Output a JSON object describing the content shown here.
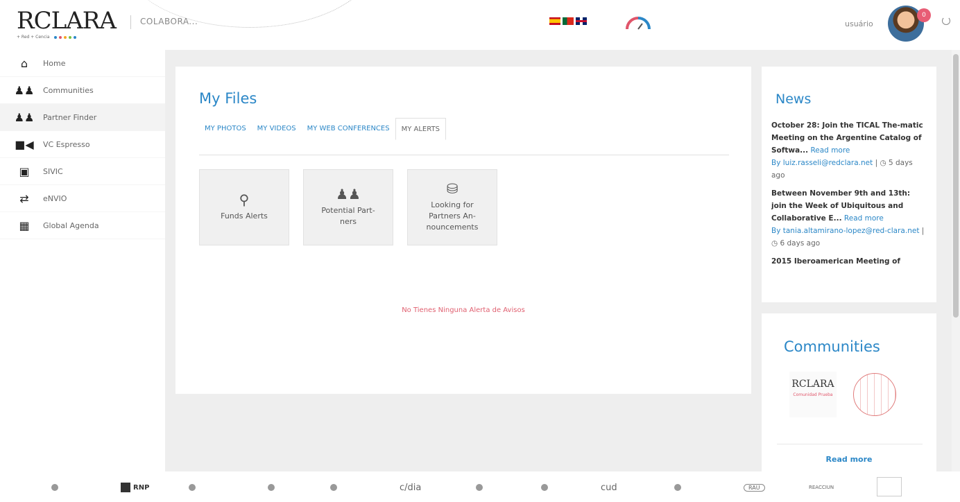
{
  "header": {
    "logo_mark": "RCLARA",
    "logo_tag": "+ Red + Cencia",
    "logo_dot_colors": [
      "#2b87c7",
      "#e0556a",
      "#f5a623",
      "#7ac143",
      "#2b87c7"
    ],
    "app_name": "COLABORA...",
    "languages": [
      "es",
      "pt",
      "en"
    ],
    "gauge_colors": [
      "#e0556a",
      "#2b87c7"
    ],
    "user_label": "usuário",
    "notification_count": "0"
  },
  "sidebar": {
    "items": [
      {
        "label": "Home",
        "icon": "home-icon"
      },
      {
        "label": "Communities",
        "icon": "group-icon"
      },
      {
        "label": "Partner Finder",
        "icon": "users-icon"
      },
      {
        "label": "VC Espresso",
        "icon": "video-camera-icon"
      },
      {
        "label": "SIVIC",
        "icon": "sivic-icon"
      },
      {
        "label": "eNVIO",
        "icon": "exchange-icon"
      },
      {
        "label": "Global Agenda",
        "icon": "calendar-icon"
      }
    ]
  },
  "main": {
    "title": "My Files",
    "tabs": [
      {
        "label": "MY PHOTOS"
      },
      {
        "label": "MY VIDEOS"
      },
      {
        "label": "MY WEB CONFERENCES"
      },
      {
        "label": "MY ALERTS"
      }
    ],
    "alert_cards": [
      {
        "label": "Funds Alerts",
        "icon": "search-icon"
      },
      {
        "label": "Potential Part-\nners",
        "icon": "users-icon"
      },
      {
        "label": "Looking for\nPartners An-\nnouncements",
        "icon": "database-icon"
      }
    ],
    "empty_message": "No Tienes Ninguna Alerta de Avisos"
  },
  "news": {
    "title": "News",
    "items": [
      {
        "title": "October 28: Join the TICAL The-matic Meeting on the Argentine Catalog of Softwa...",
        "more": "Read more",
        "author": "By luiz.rasseli@redclara.net",
        "ago": "5 days ago"
      },
      {
        "title": "Between November 9th and 13th: join the Week of Ubiquitous and Collaborative E...",
        "more": "Read more",
        "author": "By tania.altamirano-lopez@red-clara.net",
        "ago": "6 days ago"
      },
      {
        "title": "2015 Iberoamerican Meeting of",
        "more": "",
        "author": "",
        "ago": ""
      }
    ]
  },
  "communities": {
    "title": "Communities",
    "clara_mark": "RCLARA",
    "clara_sub": "Comunidad Prueba",
    "read_more": "Read more"
  },
  "footer": {
    "partners": [
      "",
      "RNP",
      "",
      "",
      "",
      "c/dia",
      "",
      "",
      "cud",
      "",
      "RAU",
      "REACCIUN",
      ""
    ]
  }
}
